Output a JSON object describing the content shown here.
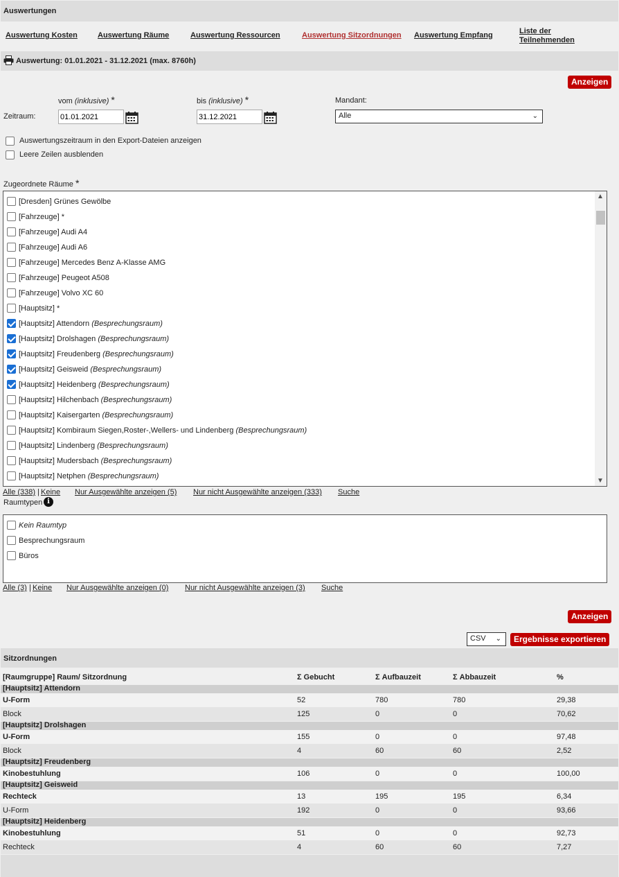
{
  "header": {
    "title": "Auswertungen"
  },
  "nav": [
    {
      "label": "Auswertung Kosten",
      "active": false
    },
    {
      "label": "Auswertung Räume",
      "active": false
    },
    {
      "label": "Auswertung Ressourcen",
      "active": false
    },
    {
      "label": "Auswertung Sitzordnungen",
      "active": true
    },
    {
      "label": "Auswertung Empfang",
      "active": false
    },
    {
      "label_line1": "Liste der",
      "label_line2": "Teilnehmenden",
      "active": false
    }
  ],
  "range_bar": {
    "title": "Auswertung: 01.01.2021 - 31.12.2021 (max. 8760h)",
    "print_icon": "printer-icon"
  },
  "show_button": "Anzeigen",
  "form": {
    "zeitraum_label": "Zeitraum:",
    "from_label": "vom",
    "from_hint": "(inklusive)",
    "to_label": "bis",
    "to_hint": "(inklusive)",
    "required_mark": "*",
    "from_value": "01.01.2021",
    "to_value": "31.12.2021",
    "calendar_icon": "calendar-icon",
    "mandant_label": "Mandant:",
    "mandant_value": "Alle",
    "option1": "Auswertungszeitraum in den Export-Dateien anzeigen",
    "option2": "Leere Zeilen ausblenden"
  },
  "rooms": {
    "label": "Zugeordnete Räume",
    "required_mark": "*",
    "items": [
      {
        "text": "[Dresden] Grünes Gewölbe",
        "type": "",
        "checked": false
      },
      {
        "text": "[Fahrzeuge] *",
        "type": "",
        "checked": false
      },
      {
        "text": "[Fahrzeuge] Audi A4",
        "type": "",
        "checked": false
      },
      {
        "text": "[Fahrzeuge] Audi A6",
        "type": "",
        "checked": false
      },
      {
        "text": "[Fahrzeuge] Mercedes Benz A-Klasse AMG",
        "type": "",
        "checked": false
      },
      {
        "text": "[Fahrzeuge] Peugeot A508",
        "type": "",
        "checked": false
      },
      {
        "text": "[Fahrzeuge] Volvo XC 60",
        "type": "",
        "checked": false
      },
      {
        "text": "[Hauptsitz] *",
        "type": "",
        "checked": false
      },
      {
        "text": "[Hauptsitz] Attendorn",
        "type": "(Besprechungsraum)",
        "checked": true
      },
      {
        "text": "[Hauptsitz] Drolshagen",
        "type": "(Besprechungsraum)",
        "checked": true
      },
      {
        "text": "[Hauptsitz] Freudenberg",
        "type": "(Besprechungsraum)",
        "checked": true
      },
      {
        "text": "[Hauptsitz] Geisweid",
        "type": "(Besprechungsraum)",
        "checked": true
      },
      {
        "text": "[Hauptsitz] Heidenberg",
        "type": "(Besprechungsraum)",
        "checked": true
      },
      {
        "text": "[Hauptsitz] Hilchenbach",
        "type": "(Besprechungsraum)",
        "checked": false
      },
      {
        "text": "[Hauptsitz] Kaisergarten",
        "type": "(Besprechungsraum)",
        "checked": false
      },
      {
        "text": "[Hauptsitz] Kombiraum Siegen,Roster-,Wellers- und Lindenberg",
        "type": "(Besprechungsraum)",
        "checked": false
      },
      {
        "text": "[Hauptsitz] Lindenberg",
        "type": "(Besprechungsraum)",
        "checked": false
      },
      {
        "text": "[Hauptsitz] Mudersbach",
        "type": "(Besprechungsraum)",
        "checked": false
      },
      {
        "text": "[Hauptsitz] Netphen",
        "type": "(Besprechungsraum)",
        "checked": false
      }
    ],
    "links": {
      "all": "Alle (338)",
      "sep": "|",
      "none": "Keine",
      "selected": "Nur Ausgewählte anzeigen (5)",
      "unselected": "Nur nicht Ausgewählte anzeigen (333)",
      "search": "Suche"
    }
  },
  "roomtypes": {
    "label": "Raumtypen",
    "info_icon": "info-icon",
    "items": [
      {
        "text": "Kein Raumtyp",
        "italic": true,
        "checked": false
      },
      {
        "text": "Besprechungsraum",
        "italic": false,
        "checked": false
      },
      {
        "text": "Büros",
        "italic": false,
        "checked": false
      }
    ],
    "links": {
      "all": "Alle (3)",
      "sep": "|",
      "none": "Keine",
      "selected": "Nur Ausgewählte anzeigen (0)",
      "unselected": "Nur nicht Ausgewählte anzeigen (3)",
      "search": "Suche"
    }
  },
  "export": {
    "format": "CSV",
    "button": "Ergebnisse exportieren"
  },
  "results": {
    "title": "Sitzordnungen",
    "columns": [
      "[Raumgruppe] Raum/ Sitzordnung",
      "Σ Gebucht",
      "Σ Aufbauzeit",
      "Σ Abbauzeit",
      "%"
    ],
    "groups": [
      {
        "name": "[Hauptsitz] Attendorn",
        "rows": [
          {
            "name": "U-Form",
            "bold": true,
            "gebucht": "52",
            "aufbau": "780",
            "abbau": "780",
            "pct": "29,38"
          },
          {
            "name": "Block",
            "bold": false,
            "gebucht": "125",
            "aufbau": "0",
            "abbau": "0",
            "pct": "70,62"
          }
        ]
      },
      {
        "name": "[Hauptsitz] Drolshagen",
        "rows": [
          {
            "name": "U-Form",
            "bold": true,
            "gebucht": "155",
            "aufbau": "0",
            "abbau": "0",
            "pct": "97,48"
          },
          {
            "name": "Block",
            "bold": false,
            "gebucht": "4",
            "aufbau": "60",
            "abbau": "60",
            "pct": "2,52"
          }
        ]
      },
      {
        "name": "[Hauptsitz] Freudenberg",
        "rows": [
          {
            "name": "Kinobestuhlung",
            "bold": true,
            "gebucht": "106",
            "aufbau": "0",
            "abbau": "0",
            "pct": "100,00"
          }
        ]
      },
      {
        "name": "[Hauptsitz] Geisweid",
        "rows": [
          {
            "name": "Rechteck",
            "bold": true,
            "gebucht": "13",
            "aufbau": "195",
            "abbau": "195",
            "pct": "6,34"
          },
          {
            "name": "U-Form",
            "bold": false,
            "gebucht": "192",
            "aufbau": "0",
            "abbau": "0",
            "pct": "93,66"
          }
        ]
      },
      {
        "name": "[Hauptsitz] Heidenberg",
        "rows": [
          {
            "name": "Kinobestuhlung",
            "bold": true,
            "gebucht": "51",
            "aufbau": "0",
            "abbau": "0",
            "pct": "92,73"
          },
          {
            "name": "Rechteck",
            "bold": false,
            "gebucht": "4",
            "aufbau": "60",
            "abbau": "60",
            "pct": "7,27"
          }
        ]
      }
    ]
  }
}
